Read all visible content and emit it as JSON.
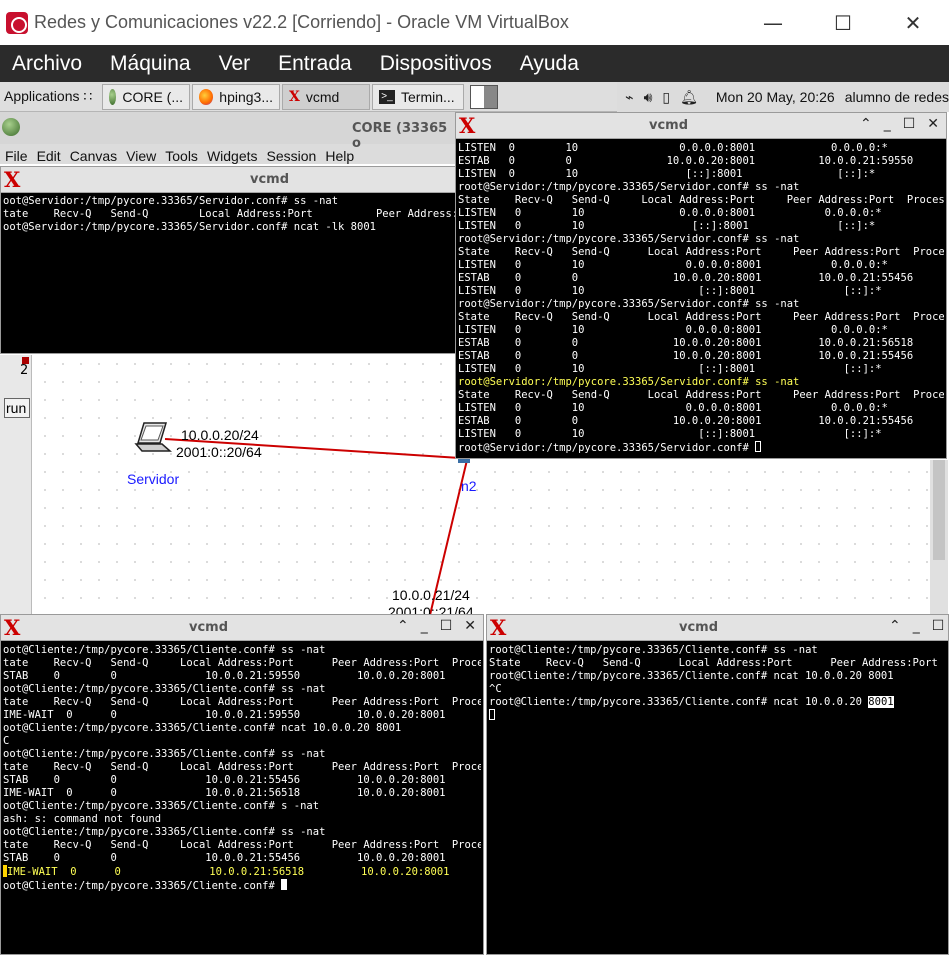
{
  "window": {
    "title": "Redes y Comunicaciones v22.2 [Corriendo] - Oracle VM VirtualBox",
    "minimize": "—",
    "maximize": "☐",
    "close": "✕"
  },
  "vbox_menu": [
    "Archivo",
    "Máquina",
    "Ver",
    "Entrada",
    "Dispositivos",
    "Ayuda"
  ],
  "guest_panel": {
    "tasks": [
      {
        "label": "Applications ∷",
        "icon": "applications-icon"
      },
      {
        "label": "CORE (...",
        "icon": "core-icon"
      },
      {
        "label": "hping3...",
        "icon": "firefox-icon"
      },
      {
        "label": "vcmd",
        "icon": "xterm-icon"
      },
      {
        "label": "Termin...",
        "icon": "terminal-icon"
      }
    ],
    "clock": "Mon 20 May, 20:26",
    "user": "alumno de redes"
  },
  "core": {
    "title": "CORE (33365 o",
    "menu": [
      "File",
      "Edit",
      "Canvas",
      "View",
      "Tools",
      "Widgets",
      "Session",
      "Help"
    ],
    "run_button": "run",
    "tool_number": "2",
    "nodes": {
      "servidor_name": "Servidor",
      "servidor_ipv4": "10.0.0.20/24",
      "servidor_ipv6": "2001:0::20/64",
      "switch_name": "n2",
      "cliente_ipv4": "10.0.0.21/24",
      "cliente_ipv6": "2001:0::21/64"
    }
  },
  "colors": {
    "link": "#cc0000",
    "terminal_bg": "#000000",
    "terminal_fg": "#ffffff",
    "terminal_highlight": "#ffff55"
  },
  "terminals": {
    "servidor_small": {
      "title": "vcmd",
      "lines": [
        "oot@Servidor:/tmp/pycore.33365/Servidor.conf# ss -nat",
        "tate    Recv-Q   Send-Q        Local Address:Port          Peer Address:Po",
        "oot@Servidor:/tmp/pycore.33365/Servidor.conf# ncat -lk 8001"
      ]
    },
    "servidor_big": {
      "title": "vcmd",
      "lines": [
        "LISTEN  0        10                0.0.0.0:8001            0.0.0.0:*",
        "ESTAB   0        0               10.0.0.20:8001          10.0.0.21:59550",
        "LISTEN  0        10                 [::]:8001               [::]:*",
        "root@Servidor:/tmp/pycore.33365/Servidor.conf# ss -nat",
        "State    Recv-Q   Send-Q     Local Address:Port     Peer Address:Port  Process",
        "LISTEN   0        10               0.0.0.0:8001           0.0.0.0:*",
        "LISTEN   0        10                 [::]:8001              [::]:*",
        "root@Servidor:/tmp/pycore.33365/Servidor.conf# ss -nat",
        "State    Recv-Q   Send-Q      Local Address:Port     Peer Address:Port  Process",
        "LISTEN   0        10                0.0.0.0:8001           0.0.0.0:*",
        "ESTAB    0        0               10.0.0.20:8001         10.0.0.21:55456",
        "LISTEN   0        10                  [::]:8001              [::]:*",
        "root@Servidor:/tmp/pycore.33365/Servidor.conf# ss -nat",
        "State    Recv-Q   Send-Q      Local Address:Port     Peer Address:Port  Process",
        "LISTEN   0        10                0.0.0.0:8001           0.0.0.0:*",
        "ESTAB    0        0               10.0.0.20:8001         10.0.0.21:56518",
        "ESTAB    0        0               10.0.0.20:8001         10.0.0.21:55456",
        "LISTEN   0        10                  [::]:8001              [::]:*",
        "root@Servidor:/tmp/pycore.33365/Servidor.conf# ss -nat",
        "State    Recv-Q   Send-Q      Local Address:Port     Peer Address:Port  Process",
        "LISTEN   0        10                0.0.0.0:8001           0.0.0.0:*",
        "ESTAB    0        0               10.0.0.20:8001         10.0.0.21:55456",
        "LISTEN   0        10                  [::]:8001              [::]:*",
        "root@Servidor:/tmp/pycore.33365/Servidor.conf# "
      ]
    },
    "cliente_left": {
      "title": "vcmd",
      "lines": [
        "oot@Cliente:/tmp/pycore.33365/Cliente.conf# ss -nat",
        "tate    Recv-Q   Send-Q     Local Address:Port      Peer Address:Port  Process",
        "STAB    0        0              10.0.0.21:59550         10.0.0.20:8001",
        "oot@Cliente:/tmp/pycore.33365/Cliente.conf# ss -nat",
        "tate    Recv-Q   Send-Q     Local Address:Port      Peer Address:Port  Process",
        "IME-WAIT  0      0              10.0.0.21:59550         10.0.0.20:8001",
        "oot@Cliente:/tmp/pycore.33365/Cliente.conf# ncat 10.0.0.20 8001",
        "C",
        "oot@Cliente:/tmp/pycore.33365/Cliente.conf# ss -nat",
        "tate    Recv-Q   Send-Q     Local Address:Port      Peer Address:Port  Process",
        "STAB    0        0              10.0.0.21:55456         10.0.0.20:8001",
        "IME-WAIT  0      0              10.0.0.21:56518         10.0.0.20:8001",
        "oot@Cliente:/tmp/pycore.33365/Cliente.conf# s -nat",
        "ash: s: command not found",
        "oot@Cliente:/tmp/pycore.33365/Cliente.conf# ss -nat",
        "tate    Recv-Q   Send-Q     Local Address:Port      Peer Address:Port  Process",
        "STAB    0        0              10.0.0.21:55456         10.0.0.20:8001",
        "IME-WAIT  0      0              10.0.0.21:56518         10.0.0.20:8001",
        "oot@Cliente:/tmp/pycore.33365/Cliente.conf# "
      ]
    },
    "cliente_right": {
      "title": "vcmd",
      "lines": [
        "root@Cliente:/tmp/pycore.33365/Cliente.conf# ss -nat",
        "State    Recv-Q   Send-Q      Local Address:Port      Peer Address:Port  Process",
        "root@Cliente:/tmp/pycore.33365/Cliente.conf# ncat 10.0.0.20 8001",
        "^C",
        "root@Cliente:/tmp/pycore.33365/Cliente.conf# ncat 10.0.0.20 ",
        "8001"
      ]
    }
  }
}
